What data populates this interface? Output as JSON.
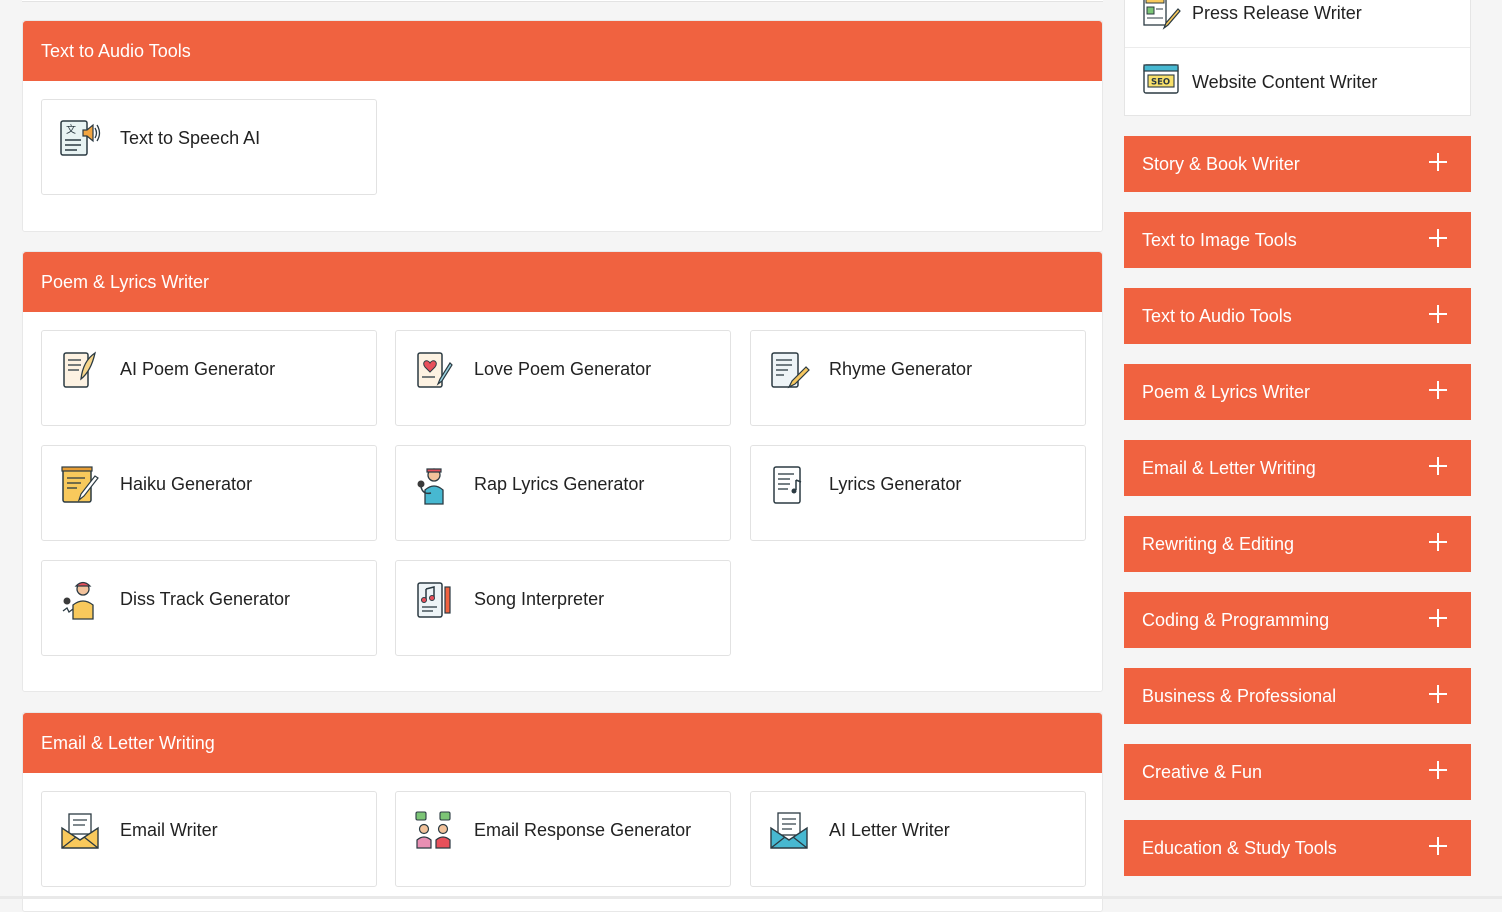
{
  "main": {
    "sections": [
      {
        "title": "Text to Audio Tools",
        "tools": [
          {
            "label": "Text to Speech AI",
            "icon": "text-to-speech-icon"
          }
        ]
      },
      {
        "title": "Poem & Lyrics Writer",
        "tools": [
          {
            "label": "AI Poem Generator",
            "icon": "quill-scroll-icon"
          },
          {
            "label": "Love Poem Generator",
            "icon": "love-letter-icon"
          },
          {
            "label": "Rhyme Generator",
            "icon": "rhyme-document-icon"
          },
          {
            "label": "Haiku Generator",
            "icon": "haiku-paper-icon"
          },
          {
            "label": "Rap Lyrics Generator",
            "icon": "rapper-microphone-icon"
          },
          {
            "label": "Lyrics Generator",
            "icon": "lyrics-sheet-icon"
          },
          {
            "label": "Diss Track Generator",
            "icon": "diss-track-rapper-icon"
          },
          {
            "label": "Song Interpreter",
            "icon": "song-notes-scroll-icon"
          }
        ]
      },
      {
        "title": "Email & Letter Writing",
        "tools": [
          {
            "label": "Email Writer",
            "icon": "envelope-letter-icon"
          },
          {
            "label": "Email Response Generator",
            "icon": "people-chat-icon"
          },
          {
            "label": "AI Letter Writer",
            "icon": "open-envelope-icon"
          }
        ]
      }
    ]
  },
  "sidebar": {
    "links": [
      {
        "label": "Press Release Writer",
        "icon": "press-release-icon"
      },
      {
        "label": "Website Content Writer",
        "icon": "seo-browser-icon"
      }
    ],
    "categories": [
      "Story & Book Writer",
      "Text to Image Tools",
      "Text to Audio Tools",
      "Poem & Lyrics Writer",
      "Email & Letter Writing",
      "Rewriting & Editing",
      "Coding & Programming",
      "Business & Professional",
      "Creative & Fun",
      "Education & Study Tools"
    ]
  },
  "colors": {
    "accent": "#f06240",
    "card_border": "#e2e2e2",
    "page_bg": "#f5f5f5"
  }
}
